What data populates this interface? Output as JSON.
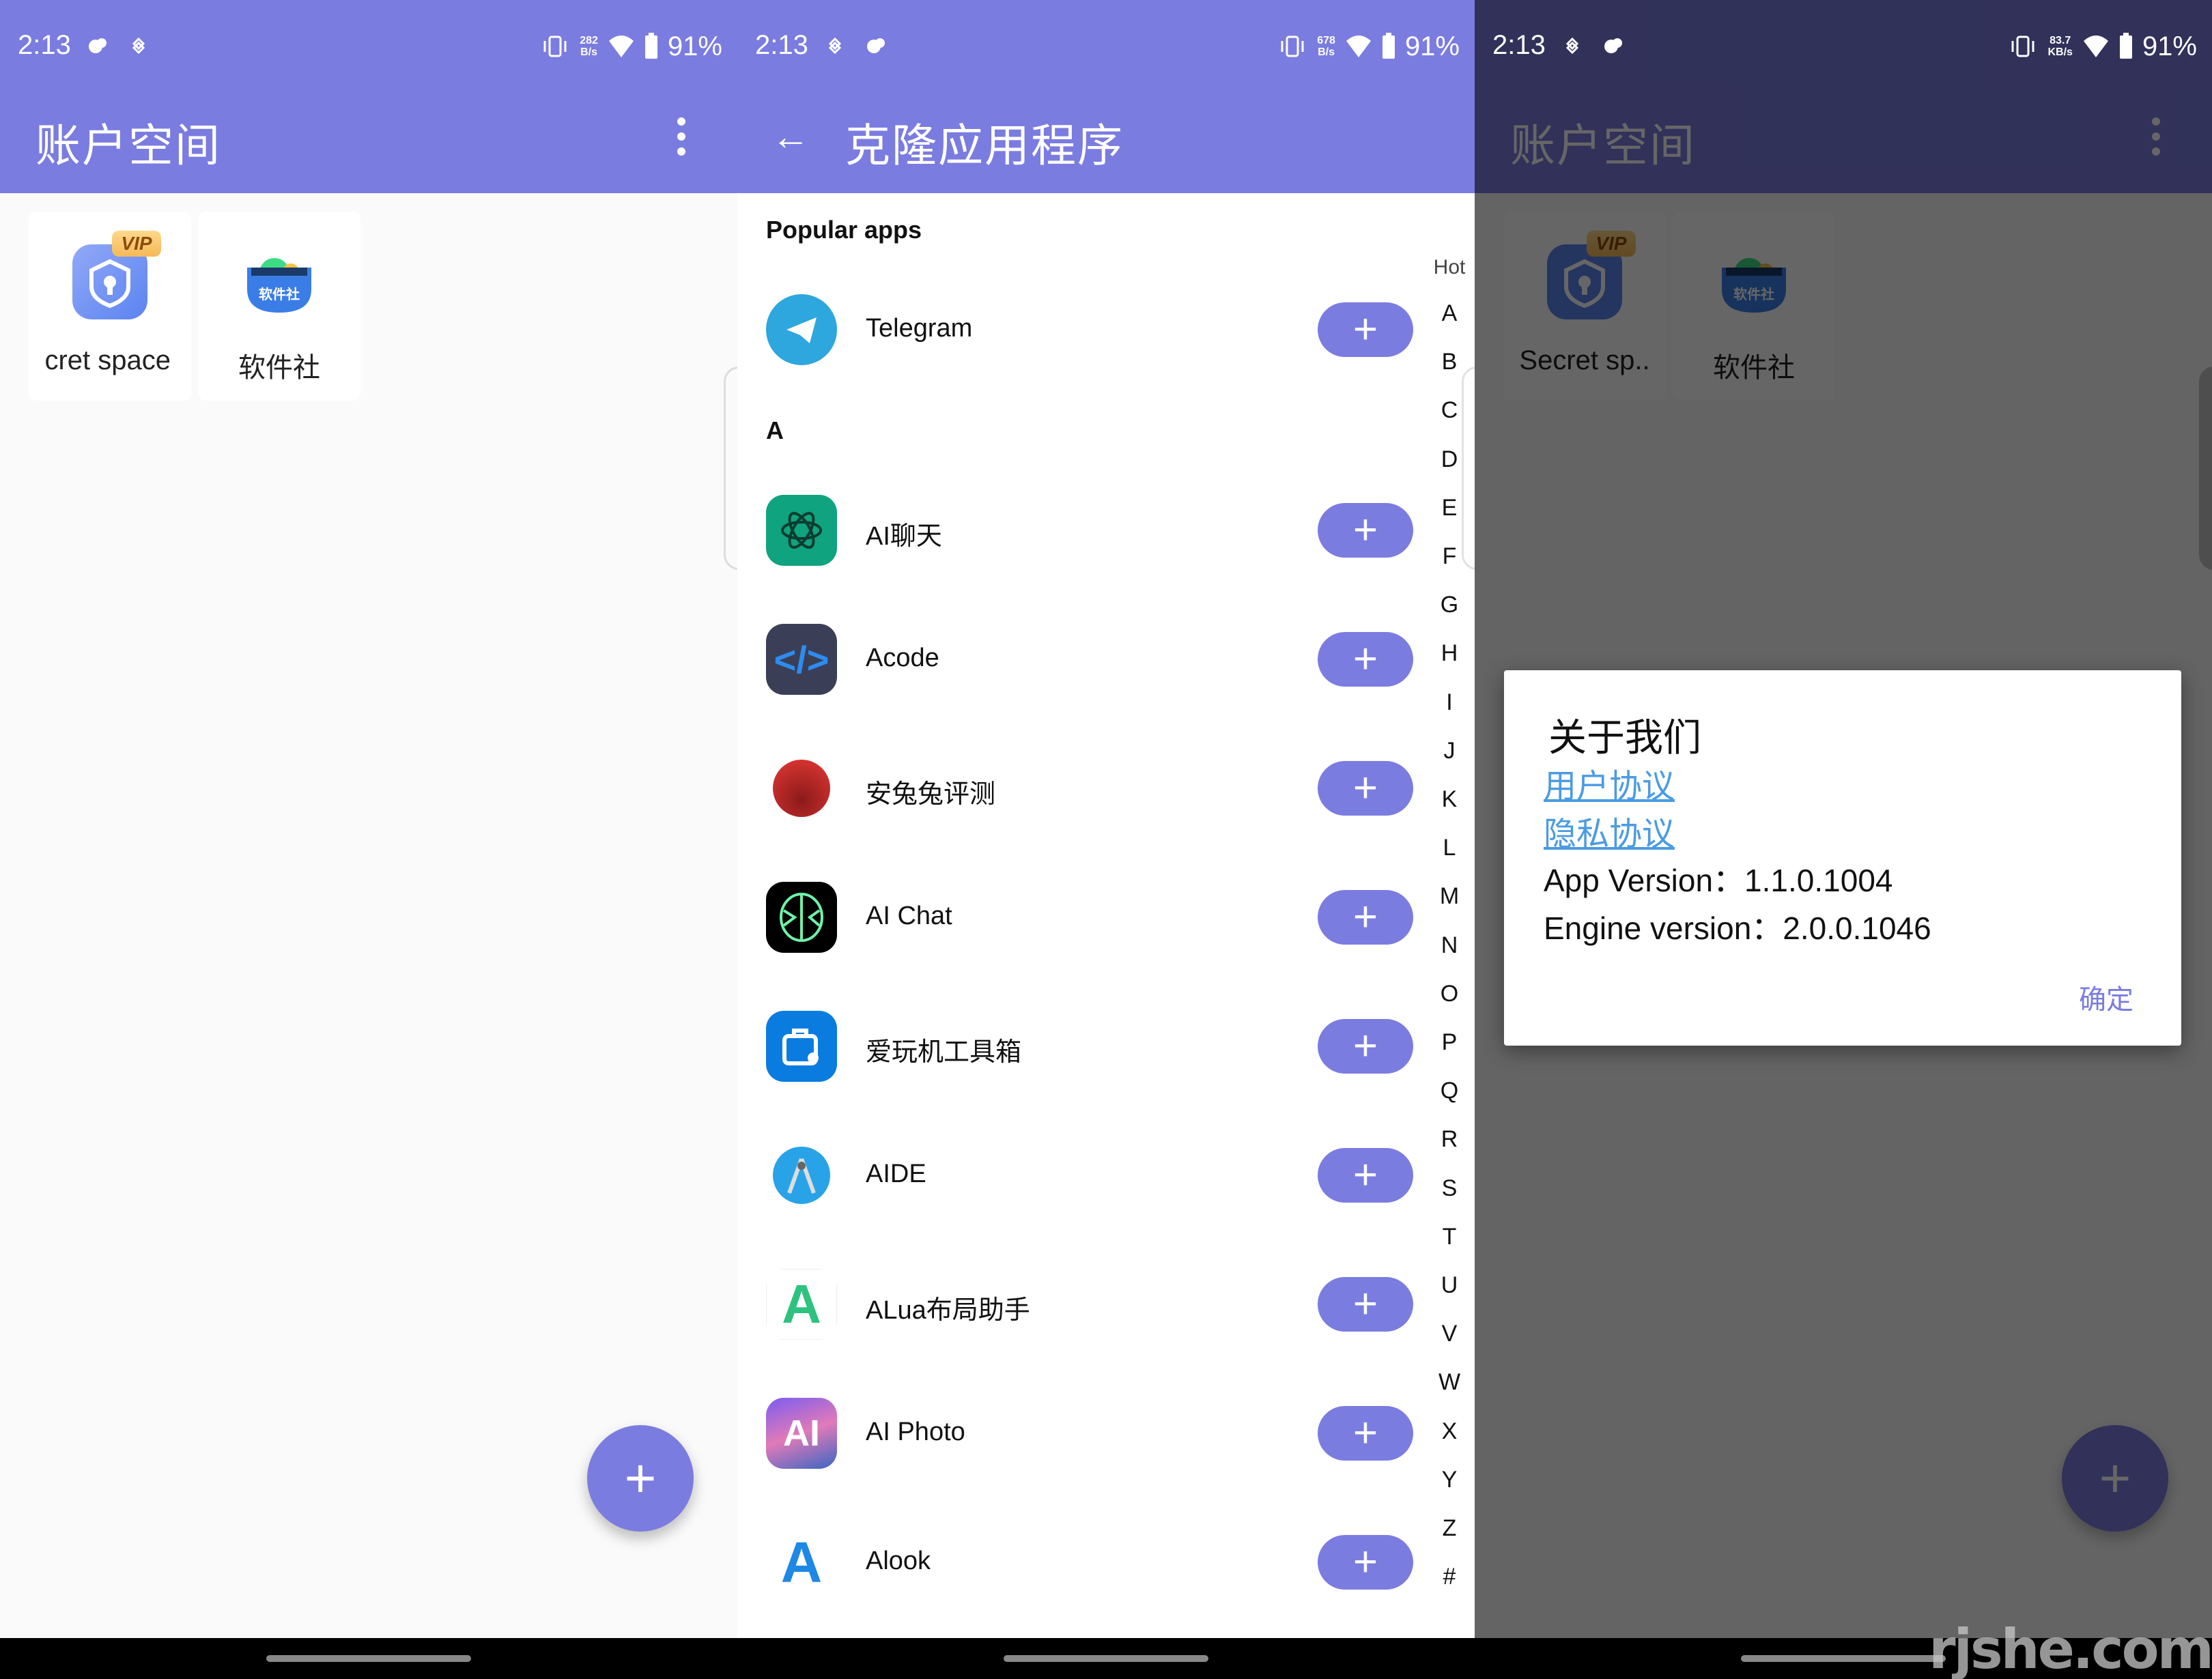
{
  "colors": {
    "primary": "#7b7ce0",
    "link": "#4a9be3",
    "scrim": "#646464"
  },
  "panels": [
    {
      "status": {
        "time": "2:13",
        "net_speed_value": "282",
        "net_speed_unit": "B/s",
        "battery": "91%"
      },
      "appbar": {
        "title": "账户空间"
      },
      "spaces": [
        {
          "label": "cret space",
          "badge": "VIP",
          "icon": "secret-space-shield-icon"
        },
        {
          "label": "软件社",
          "icon": "software-club-icon",
          "icon_text": "软件社"
        }
      ],
      "fab_label": "+"
    },
    {
      "status": {
        "time": "2:13",
        "net_speed_value": "678",
        "net_speed_unit": "B/s",
        "battery": "91%"
      },
      "appbar": {
        "title": "克隆应用程序",
        "back": "←"
      },
      "sections": {
        "popular": "Popular apps",
        "a": "A"
      },
      "popular_apps": [
        {
          "name": "Telegram",
          "icon": "telegram-icon"
        }
      ],
      "a_apps": [
        {
          "name": "AI聊天",
          "icon": "ai-chat-cn-icon"
        },
        {
          "name": "Acode",
          "icon": "acode-icon"
        },
        {
          "name": "安兔兔评测",
          "icon": "antutu-icon"
        },
        {
          "name": "AI Chat",
          "icon": "ai-chat-brain-icon"
        },
        {
          "name": "爱玩机工具箱",
          "icon": "toolbox-icon"
        },
        {
          "name": "AIDE",
          "icon": "aide-icon"
        },
        {
          "name": "ALua布局助手",
          "icon": "alua-icon"
        },
        {
          "name": "AI Photo",
          "icon": "ai-photo-icon"
        },
        {
          "name": "Alook",
          "icon": "alook-icon"
        }
      ],
      "add_label": "+",
      "index": [
        "Hot",
        "A",
        "B",
        "C",
        "D",
        "E",
        "F",
        "G",
        "H",
        "I",
        "J",
        "K",
        "L",
        "M",
        "N",
        "O",
        "P",
        "Q",
        "R",
        "S",
        "T",
        "U",
        "V",
        "W",
        "X",
        "Y",
        "Z",
        "#"
      ]
    },
    {
      "status": {
        "time": "2:13",
        "net_speed_value": "83.7",
        "net_speed_unit": "KB/s",
        "battery": "91%"
      },
      "appbar": {
        "title": "账户空间"
      },
      "spaces": [
        {
          "label": "Secret sp..",
          "badge": "VIP",
          "icon": "secret-space-shield-icon"
        },
        {
          "label": "软件社",
          "icon": "software-club-icon",
          "icon_text": "软件社"
        }
      ],
      "fab_label": "+",
      "dialog": {
        "title": "关于我们",
        "links": [
          "用户协议",
          "隐私协议"
        ],
        "app_version": "App Version：1.1.0.1004",
        "engine_version": "Engine version：2.0.0.1046",
        "ok": "确定"
      }
    }
  ],
  "watermark": "rjshe.com"
}
